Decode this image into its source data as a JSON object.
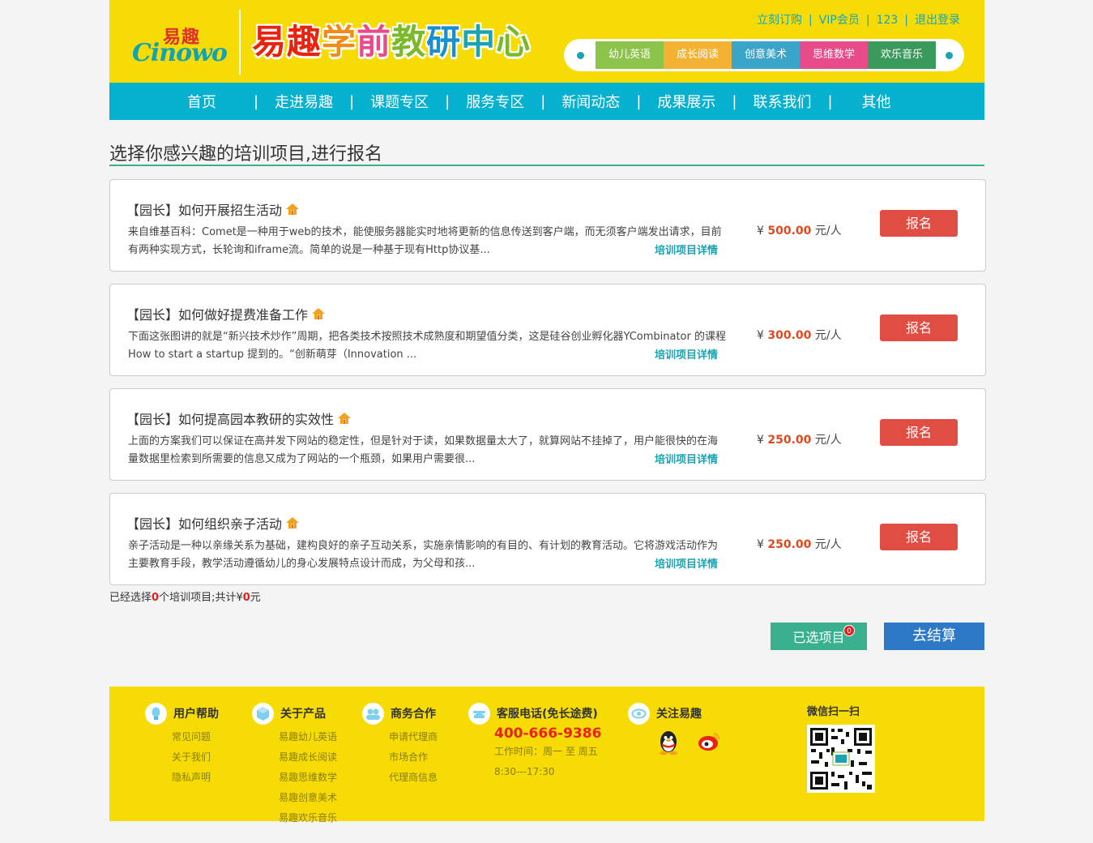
{
  "header": {
    "logo_cn": "易趣",
    "logo_en": "Cinowo",
    "brand_title": [
      "易",
      "趣",
      "学",
      "前",
      "教",
      "研",
      "中",
      "心"
    ],
    "brand_colors": [
      "#e8230f",
      "#e8230f",
      "#f18b1b",
      "#e84b8a",
      "#7ab82c",
      "#1a8fd0",
      "#1aa3b0",
      "#7ab82c"
    ],
    "top_links": [
      "立刻订购",
      "VIP会员",
      "123",
      "退出登录"
    ],
    "categories": [
      {
        "label": "幼儿英语",
        "color": "#8cc34a"
      },
      {
        "label": "成长阅读",
        "color": "#f4b233"
      },
      {
        "label": "创意美术",
        "color": "#3aa5c8"
      },
      {
        "label": "思维数学",
        "color": "#e84b8a"
      },
      {
        "label": "欢乐音乐",
        "color": "#3a9a5b"
      }
    ]
  },
  "nav": {
    "items": [
      "首页",
      "走进易趣",
      "课题专区",
      "服务专区",
      "新闻动态",
      "成果展示",
      "联系我们",
      "其他"
    ]
  },
  "section_title": "选择你感兴趣的培训项目,进行报名",
  "courses": [
    {
      "title": "【园长】如何开展招生活动",
      "desc": "来自维基百科：Comet是一种用于web的技术，能使服务器能实时地将更新的信息传送到客户端，而无须客户端发出请求，目前有两种实现方式，长轮询和iframe流。简单的说是一种基于现有Http协议基...",
      "detail": "培训项目详情",
      "price_prefix": "¥",
      "price": "500.00",
      "price_unit": "元/人",
      "apply": "报名"
    },
    {
      "title": "【园长】如何做好提费准备工作",
      "desc": "下面这张图讲的就是“新兴技术炒作”周期，把各类技术按照技术成熟度和期望值分类，这是硅谷创业孵化器YCombinator 的课程 How to start a startup 提到的。“创新萌芽（Innovation ...",
      "detail": "培训项目详情",
      "price_prefix": "¥",
      "price": "300.00",
      "price_unit": "元/人",
      "apply": "报名"
    },
    {
      "title": "【园长】如何提高园本教研的实效性",
      "desc": "上面的方案我们可以保证在高并发下网站的稳定性，但是针对于读，如果数据量太大了，就算网站不挂掉了，用户能很快的在海量数据里检索到所需要的信息又成为了网站的一个瓶颈，如果用户需要很...",
      "detail": "培训项目详情",
      "price_prefix": "¥",
      "price": "250.00",
      "price_unit": "元/人",
      "apply": "报名"
    },
    {
      "title": "【园长】如何组织亲子活动",
      "desc": "亲子活动是一种以亲缘关系为基础，建构良好的亲子互动关系，实施亲情影响的有目的、有计划的教育活动。它将游戏活动作为主要教育手段，教学活动遵循幼儿的身心发展特点设计而成，为父母和孩...",
      "detail": "培训项目详情",
      "price_prefix": "¥",
      "price": "250.00",
      "price_unit": "元/人",
      "apply": "报名"
    }
  ],
  "summary": {
    "prefix": "已经选择",
    "count": "0",
    "middle": "个培训项目;共计¥",
    "total": "0",
    "suffix": "元"
  },
  "actions": {
    "selected_label": "已选项目",
    "selected_badge": "0",
    "checkout_label": "去结算"
  },
  "footer": {
    "help": {
      "title": "用户帮助",
      "links": [
        "常见问题",
        "关于我们",
        "隐私声明"
      ]
    },
    "products": {
      "title": "关于产品",
      "links": [
        "易趣幼儿英语",
        "易趣成长阅读",
        "易趣思维数学",
        "易趣创意美术",
        "易趣欢乐音乐"
      ]
    },
    "business": {
      "title": "商务合作",
      "links": [
        "申请代理商",
        "市场合作",
        "代理商信息"
      ]
    },
    "service": {
      "title": "客服电话(免长途费)",
      "phone": "400-666-9386",
      "hours": "工作时间：周一 至 周五",
      "time": "8:30---17:30"
    },
    "follow": {
      "title": "关注易趣",
      "icons": [
        "qq-icon",
        "weibo-icon"
      ]
    },
    "wechat": {
      "title": "微信扫一扫"
    }
  }
}
